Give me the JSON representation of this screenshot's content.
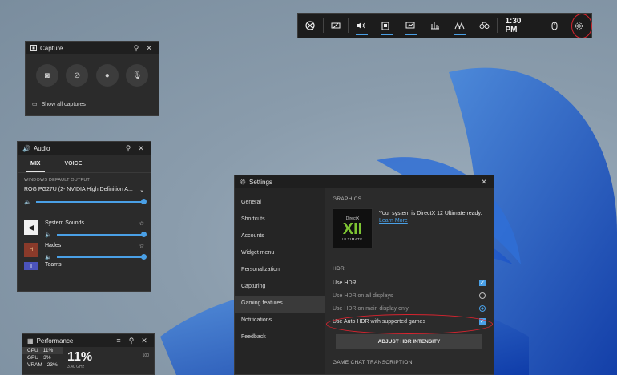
{
  "gamebar": {
    "icons": [
      "xbox-icon",
      "widget-menu-icon",
      "audio-icon",
      "capture-icon",
      "performance-icon",
      "resources-icon",
      "social-icon",
      "looking-for-group-icon"
    ],
    "time": "1:30 PM",
    "settings_icon": "gear-icon"
  },
  "capture": {
    "title": "Capture",
    "footer": "Show all captures"
  },
  "audio": {
    "title": "Audio",
    "tabs": [
      "MIX",
      "VOICE"
    ],
    "output_label": "WINDOWS DEFAULT OUTPUT",
    "device": "ROG PG27U (2- NVIDIA High Definition A...",
    "apps": [
      {
        "name": "System Sounds"
      },
      {
        "name": "Hades"
      },
      {
        "name": "Teams"
      }
    ]
  },
  "settings": {
    "title": "Settings",
    "nav": [
      "General",
      "Shortcuts",
      "Accounts",
      "Widget menu",
      "Personalization",
      "Capturing",
      "Gaming features",
      "Notifications",
      "Feedback"
    ],
    "selected_nav": "Gaming features",
    "graphics_header": "GRAPHICS",
    "dx_small": "DirectX",
    "dx_big": "XII",
    "dx_ultimate": "ULTIMATE",
    "dx_text": "Your system is DirectX 12 Ultimate ready.",
    "learn_more": "Learn More",
    "hdr_header": "HDR",
    "options": {
      "use_hdr": "Use HDR",
      "all_displays": "Use HDR on all displays",
      "main_display": "Use HDR on main display only",
      "auto_hdr": "Use Auto HDR with supported games"
    },
    "adjust_button": "ADJUST HDR INTENSITY",
    "chat_header": "GAME CHAT TRANSCRIPTION"
  },
  "performance": {
    "title": "Performance",
    "rows": [
      {
        "label": "CPU",
        "value": "11%"
      },
      {
        "label": "GPU",
        "value": "3%"
      },
      {
        "label": "VRAM",
        "value": "23%"
      }
    ],
    "big": "11%",
    "sub": "3.40 GHz",
    "max": "100"
  }
}
